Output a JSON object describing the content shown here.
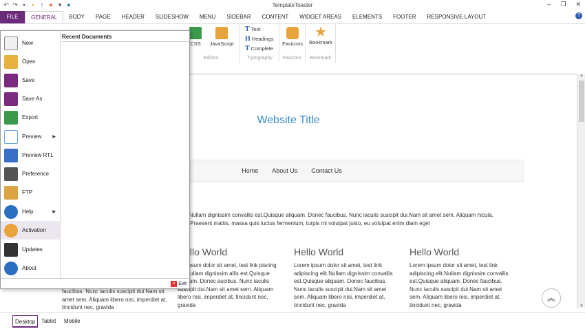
{
  "app": {
    "title": "TemplateToaster"
  },
  "window_controls": [
    "–",
    "❐",
    "✕"
  ],
  "ribbon_tabs": [
    "FILE",
    "GENERAL",
    "BODY",
    "PAGE",
    "HEADER",
    "SLIDESHOW",
    "MENU",
    "SIDEBAR",
    "CONTENT",
    "WIDGET AREAS",
    "ELEMENTS",
    "FOOTER",
    "RESPONSIVE LAYOUT"
  ],
  "ribbon": {
    "editors": {
      "css": "CSS",
      "js": "JavaScript",
      "caption": "Editors"
    },
    "typography": {
      "text": "Text",
      "headings": "Headings",
      "complete": "Complete",
      "caption": "Typography"
    },
    "favicons": {
      "label": "Favicons",
      "caption": "Favicons"
    },
    "bookmark": {
      "label": "Bookmark",
      "caption": "Bookmark"
    }
  },
  "file_menu": {
    "items": [
      {
        "label": "New",
        "color": "#e9e9e9"
      },
      {
        "label": "Open",
        "color": "#e6b13c"
      },
      {
        "label": "Save",
        "color": "#7b2b7f"
      },
      {
        "label": "Save As",
        "color": "#7b2b7f"
      },
      {
        "label": "Export",
        "color": "#3b9a4a"
      },
      {
        "label": "Preview",
        "color": "#6aa8e0"
      },
      {
        "label": "Preview RTL",
        "color": "#3a6fc8"
      },
      {
        "label": "Preference",
        "color": "#555555"
      },
      {
        "label": "FTP",
        "color": "#d9a441"
      },
      {
        "label": "Help",
        "color": "#2a6fc2"
      },
      {
        "label": "Activation",
        "color": "#e8a33a"
      },
      {
        "label": "Updates",
        "color": "#333333"
      },
      {
        "label": "About",
        "color": "#2a6fc2"
      }
    ],
    "recent_title": "Recent Documents",
    "exit_label": "Exit"
  },
  "site": {
    "title": "Website Title",
    "nav": [
      "Home",
      "About Us",
      "Contact Us"
    ],
    "intro": "elit.Nullam dignissim convallis est.Quisque aliquam. Donec faucibus. Nunc iaculis suscipit dui.Nam sit amet sem. Aliquam hicula, nisl.Praesent mattis, massa quis luctus fermentum, turpis mi volutpat justo, eu volutpat enim diam eget",
    "columns": [
      {
        "heading": "Hello World",
        "body": "em ipsum dolor sit amet, test link piscing elit.Nullam dignissim allis est.Quisque aliquam. Donec aucibus. Nunc iaculis suscipit dui.Nam sit amet sem. Aliquam libero nisi, imperdiet at, tincidunt nec, gravida"
      },
      {
        "heading": "Hello World",
        "body": "Lorem ipsum dolor sit amet, test link adipiscing elit.Nullam dignissim convallis est.Quisque aliquam. Donec faucibus. Nunc iaculis suscipit dui.Nam sit amet sem. Aliquam libero nisi, imperdiet at, tincidunt nec, gravida"
      },
      {
        "heading": "Hello World",
        "body": "Lorem ipsum dolor sit amet, test link adipiscing elit.Nullam dignissim convallis est.Quisque aliquam. Donec faucibus. Nunc iaculis suscipit dui.Nam sit amet sem. Aliquam libero nisi, imperdiet at, tincidunt nec, gravida"
      }
    ],
    "under_menu_text": "faucibus. Nunc iaculis suscipit dui.Nam sit amet sem. Aliquam libero nisi, imperdiet at, tincidunt nec, gravida"
  },
  "device_tabs": [
    "Desktop",
    "Tablet",
    "Mobile"
  ],
  "colors": {
    "accent": "#6b2a7a",
    "site_title": "#3a8ed0"
  }
}
